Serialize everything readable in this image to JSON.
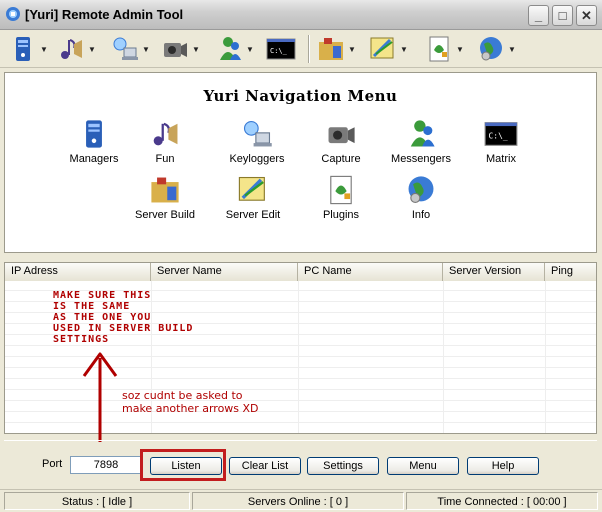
{
  "window": {
    "title": "[Yuri] Remote Admin Tool",
    "minimize_glyph": "_",
    "maximize_glyph": "□",
    "close_glyph": "✕"
  },
  "toolbar": {
    "items": [
      {
        "icon": "managers-icon"
      },
      {
        "icon": "fun-icon"
      },
      {
        "icon": "keyloggers-icon"
      },
      {
        "icon": "capture-icon"
      },
      {
        "icon": "messengers-icon"
      },
      {
        "icon": "matrix-icon"
      },
      {
        "icon": "server-build-icon"
      },
      {
        "icon": "server-edit-icon"
      },
      {
        "icon": "plugins-icon"
      },
      {
        "icon": "info-icon"
      }
    ]
  },
  "nav": {
    "title": "Yuri Navigation Menu",
    "row1": [
      "Managers",
      "Fun",
      "Keyloggers",
      "Capture",
      "Messengers",
      "Matrix"
    ],
    "row2": [
      "Server Build",
      "Server Edit",
      "Plugins",
      "Info"
    ],
    "matrix_prompt": "C:\\_"
  },
  "list": {
    "columns": [
      "IP Adress",
      "Server Name",
      "PC Name",
      "Server Version",
      "Ping"
    ]
  },
  "annotations": {
    "note1": [
      "Make sure this",
      "is the same",
      "as the one you",
      "used in server build",
      "settings"
    ],
    "note2": [
      "soz cudnt be asked to",
      "make another arrows XD"
    ]
  },
  "controls": {
    "port_label": "Port",
    "port_value": "7898",
    "buttons": [
      "Listen",
      "Clear List",
      "Settings",
      "Menu",
      "Help"
    ]
  },
  "status": {
    "status": "Status : [ Idle ]",
    "servers_online": "Servers Online : [ 0 ]",
    "time_connected": "Time Connected : [ 00:00 ]"
  },
  "colors": {
    "annotation_red": "#b00000",
    "highlight_red": "#c21d1d"
  }
}
